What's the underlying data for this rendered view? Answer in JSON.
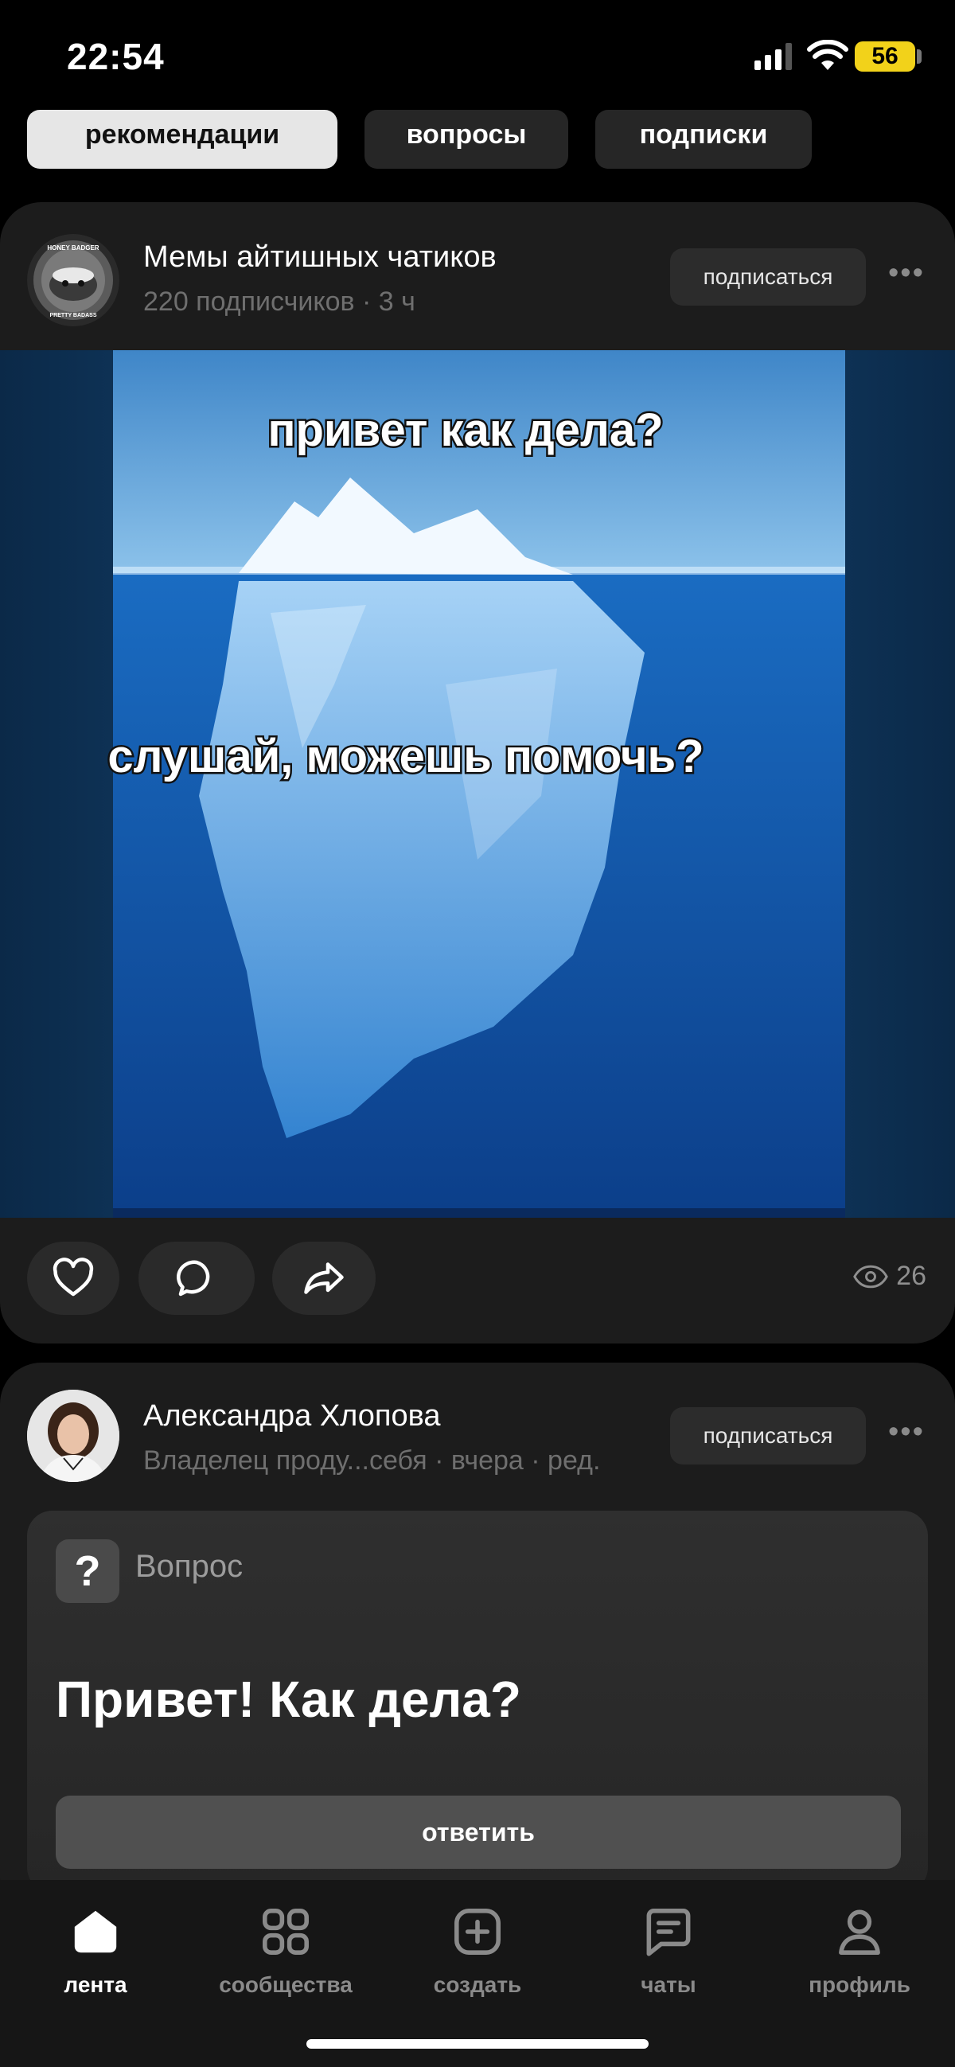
{
  "status_bar": {
    "time": "22:54",
    "battery": "56"
  },
  "tabs": [
    {
      "label": "рекомендации",
      "active": true
    },
    {
      "label": "вопросы",
      "active": false
    },
    {
      "label": "подписки",
      "active": false
    }
  ],
  "post1": {
    "author": "Мемы айтишных чатиков",
    "meta": "220 подписчиков · 3 ч",
    "subscribe_label": "подписаться",
    "avatar_lettering": [
      "HONEY BADGER",
      "PRETTY BADASS"
    ],
    "image_text": {
      "top": "привет как дела?",
      "bottom": "слушай, можешь помочь?"
    },
    "views": "26"
  },
  "post2": {
    "author": "Александра Хлопова",
    "meta": "Владелец проду...себя · вчера · ред.",
    "subscribe_label": "подписаться",
    "question_badge": "?",
    "question_label": "Вопрос",
    "question_text": "Привет! Как дела?",
    "answer_label": "ответить"
  },
  "nav": [
    {
      "label": "лента",
      "icon": "home-icon",
      "active": true
    },
    {
      "label": "сообщества",
      "icon": "grid-icon",
      "active": false
    },
    {
      "label": "создать",
      "icon": "plus-square-icon",
      "active": false
    },
    {
      "label": "чаты",
      "icon": "chat-icon",
      "active": false
    },
    {
      "label": "профиль",
      "icon": "person-icon",
      "active": false
    }
  ],
  "colors": {
    "background": "#000000",
    "card": "#1c1c1c",
    "battery": "#f2d21a",
    "ocean": "#1565b8"
  }
}
